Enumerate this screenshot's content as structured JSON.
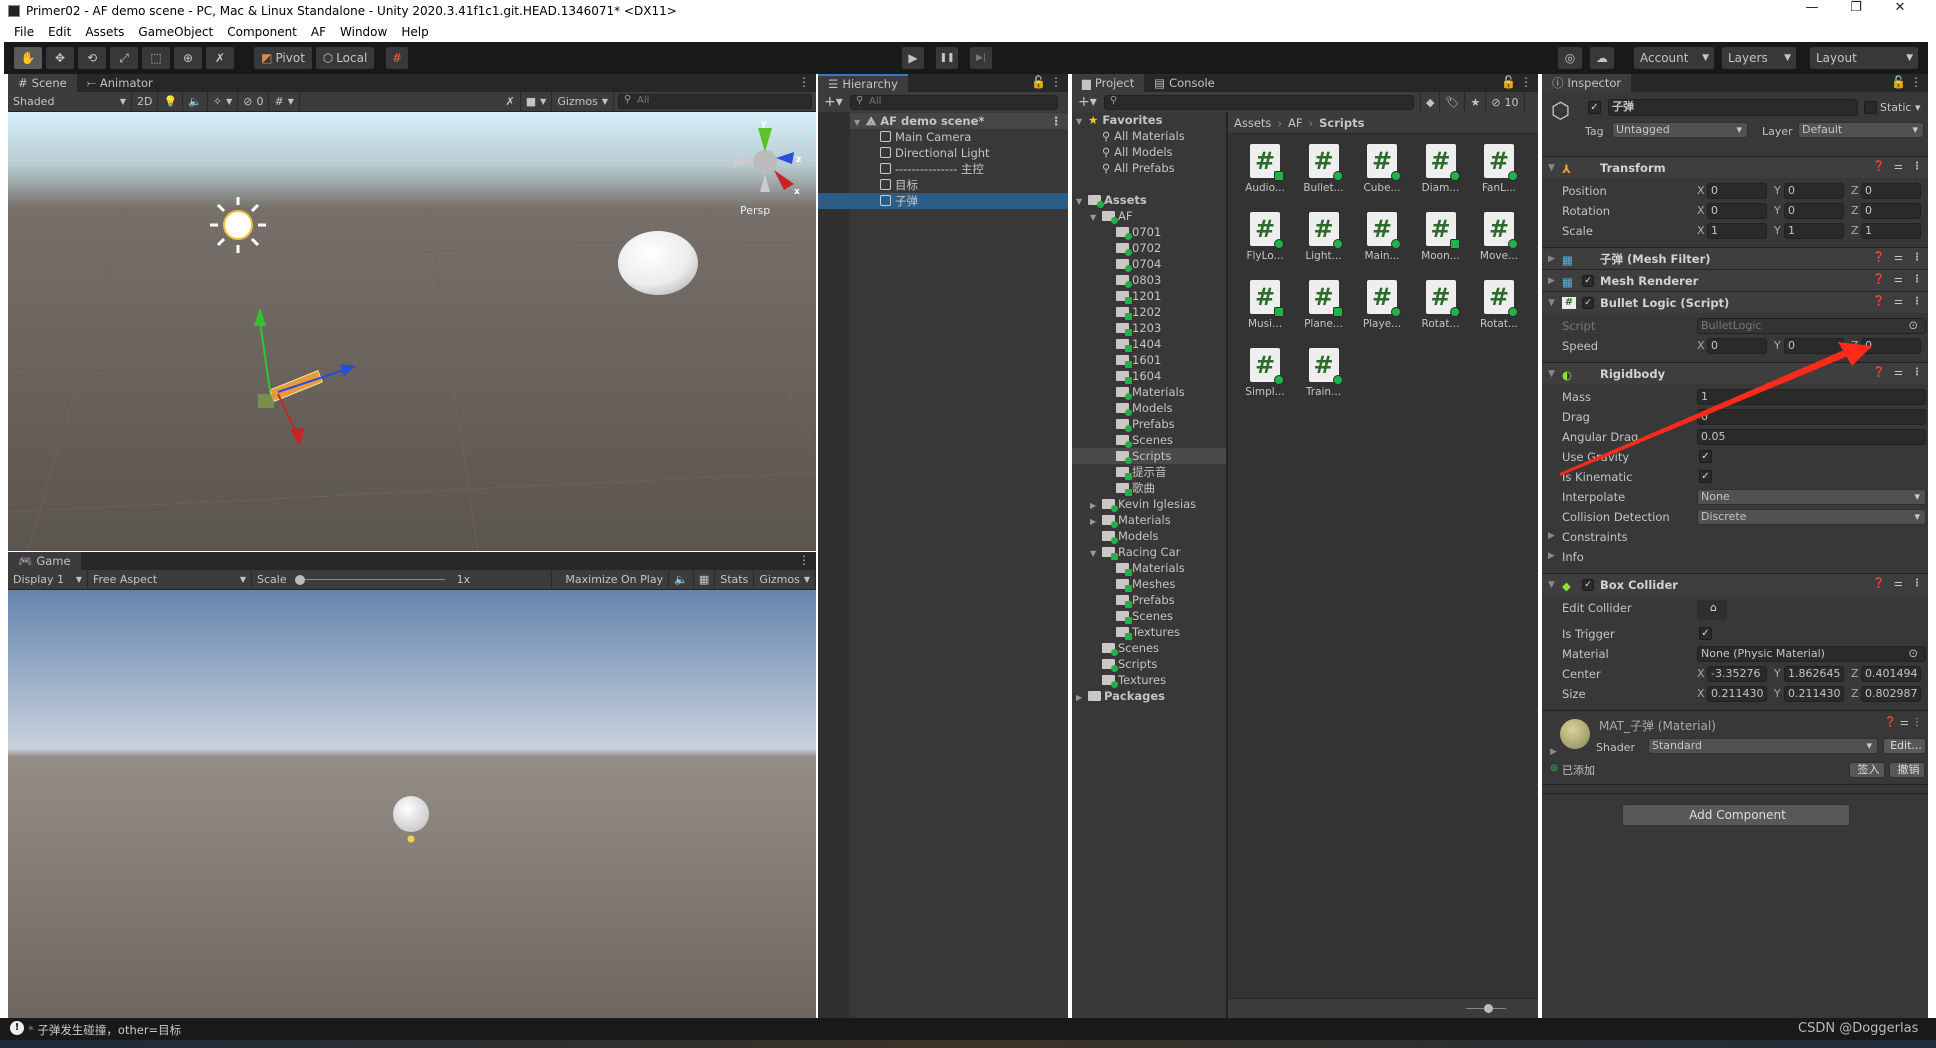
{
  "window": {
    "title": "Primer02 - AF demo scene - PC, Mac & Linux Standalone - Unity 2020.3.41f1c1.git.HEAD.1346071* <DX11>",
    "controls": [
      "—",
      "❐",
      "✕"
    ]
  },
  "menu": [
    "File",
    "Edit",
    "Assets",
    "GameObject",
    "Component",
    "AF",
    "Window",
    "Help"
  ],
  "toolbar": {
    "tools": [
      "hand-tool",
      "move-tool",
      "rotate-tool",
      "scale-tool",
      "rect-tool",
      "transform-tool",
      "custom-tool"
    ],
    "tool_glyphs": [
      "✋",
      "✥",
      "⟲",
      "⤢",
      "⬚",
      "⊕",
      "✗"
    ],
    "active_tool": "hand-tool",
    "pivot": "Pivot",
    "local": "Local",
    "play_glyphs": [
      "▶",
      "❚❚",
      "▶|"
    ],
    "account": "Account",
    "layers": "Layers",
    "layout": "Layout"
  },
  "scene": {
    "tabs": [
      "Scene",
      "Animator"
    ],
    "tab_glyphs": [
      "#",
      "⤚"
    ],
    "shading": "Shaded",
    "mode_2d": "2D",
    "hidden_count": "0",
    "gizmos": "Gizmos",
    "search_placeholder": "All",
    "projection": "Persp",
    "axis_labels": [
      "y",
      "z",
      "x"
    ]
  },
  "game": {
    "tab": "Game",
    "display": "Display 1",
    "aspect": "Free Aspect",
    "scale_label": "Scale",
    "scale_value": "1x",
    "maximize": "Maximize On Play",
    "stats": "Stats",
    "gizmos": "Gizmos"
  },
  "hierarchy": {
    "tab": "Hierarchy",
    "search_placeholder": "All",
    "scene_name": "AF demo scene*",
    "items": [
      {
        "label": "Main Camera",
        "selected": false
      },
      {
        "label": "Directional Light",
        "selected": false
      },
      {
        "label": "--------------- 主控",
        "selected": false
      },
      {
        "label": "目标",
        "selected": false
      },
      {
        "label": "子弹",
        "selected": true
      }
    ]
  },
  "project": {
    "tabs": [
      "Project",
      "Console"
    ],
    "hidden_count": "10",
    "breadcrumb": [
      "Assets",
      "AF",
      "Scripts"
    ],
    "tree": [
      {
        "label": "Favorites",
        "depth": 0,
        "arrow": "open",
        "icon": "star",
        "bold": true
      },
      {
        "label": "All Materials",
        "depth": 1,
        "arrow": "none",
        "icon": "search"
      },
      {
        "label": "All Models",
        "depth": 1,
        "arrow": "none",
        "icon": "search"
      },
      {
        "label": "All Prefabs",
        "depth": 1,
        "arrow": "none",
        "icon": "search"
      },
      {
        "label": "",
        "depth": 0,
        "arrow": "none",
        "icon": "none"
      },
      {
        "label": "Assets",
        "depth": 0,
        "arrow": "open",
        "icon": "folder",
        "vcs": "added",
        "bold": true
      },
      {
        "label": "AF",
        "depth": 1,
        "arrow": "open",
        "icon": "folder",
        "vcs": "added"
      },
      {
        "label": "0701",
        "depth": 2,
        "arrow": "none",
        "icon": "folder",
        "vcs": "added"
      },
      {
        "label": "0702",
        "depth": 2,
        "arrow": "none",
        "icon": "folder",
        "vcs": "added"
      },
      {
        "label": "0704",
        "depth": 2,
        "arrow": "none",
        "icon": "folder",
        "vcs": "added"
      },
      {
        "label": "0803",
        "depth": 2,
        "arrow": "none",
        "icon": "folder",
        "vcs": "added"
      },
      {
        "label": "1201",
        "depth": 2,
        "arrow": "none",
        "icon": "folder",
        "vcs": "modified"
      },
      {
        "label": "1202",
        "depth": 2,
        "arrow": "none",
        "icon": "folder",
        "vcs": "modified"
      },
      {
        "label": "1203",
        "depth": 2,
        "arrow": "none",
        "icon": "folder",
        "vcs": "modified"
      },
      {
        "label": "1404",
        "depth": 2,
        "arrow": "none",
        "icon": "folder",
        "vcs": "modified"
      },
      {
        "label": "1601",
        "depth": 2,
        "arrow": "none",
        "icon": "folder",
        "vcs": "modified"
      },
      {
        "label": "1604",
        "depth": 2,
        "arrow": "none",
        "icon": "folder",
        "vcs": "modified"
      },
      {
        "label": "Materials",
        "depth": 2,
        "arrow": "none",
        "icon": "folder",
        "vcs": "added"
      },
      {
        "label": "Models",
        "depth": 2,
        "arrow": "none",
        "icon": "folder",
        "vcs": "added"
      },
      {
        "label": "Prefabs",
        "depth": 2,
        "arrow": "none",
        "icon": "folder",
        "vcs": "added"
      },
      {
        "label": "Scenes",
        "depth": 2,
        "arrow": "none",
        "icon": "folder",
        "vcs": "added"
      },
      {
        "label": "Scripts",
        "depth": 2,
        "arrow": "none",
        "icon": "folder",
        "vcs": "added",
        "selected": true
      },
      {
        "label": "提示音",
        "depth": 2,
        "arrow": "none",
        "icon": "folder",
        "vcs": "modified"
      },
      {
        "label": "歌曲",
        "depth": 2,
        "arrow": "none",
        "icon": "folder",
        "vcs": "modified"
      },
      {
        "label": "Kevin Iglesias",
        "depth": 1,
        "arrow": "closed",
        "icon": "folder",
        "vcs": "added"
      },
      {
        "label": "Materials",
        "depth": 1,
        "arrow": "closed",
        "icon": "folder",
        "vcs": "added"
      },
      {
        "label": "Models",
        "depth": 1,
        "arrow": "none",
        "icon": "folder",
        "vcs": "added"
      },
      {
        "label": "Racing Car",
        "depth": 1,
        "arrow": "open",
        "icon": "folder",
        "vcs": "modified"
      },
      {
        "label": "Materials",
        "depth": 2,
        "arrow": "none",
        "icon": "folder",
        "vcs": "modified"
      },
      {
        "label": "Meshes",
        "depth": 2,
        "arrow": "none",
        "icon": "folder",
        "vcs": "modified"
      },
      {
        "label": "Prefabs",
        "depth": 2,
        "arrow": "none",
        "icon": "folder",
        "vcs": "modified"
      },
      {
        "label": "Scenes",
        "depth": 2,
        "arrow": "none",
        "icon": "folder",
        "vcs": "modified"
      },
      {
        "label": "Textures",
        "depth": 2,
        "arrow": "none",
        "icon": "folder",
        "vcs": "modified"
      },
      {
        "label": "Scenes",
        "depth": 1,
        "arrow": "none",
        "icon": "folder",
        "vcs": "added"
      },
      {
        "label": "Scripts",
        "depth": 1,
        "arrow": "none",
        "icon": "folder",
        "vcs": "added"
      },
      {
        "label": "Textures",
        "depth": 1,
        "arrow": "none",
        "icon": "folder",
        "vcs": "added"
      },
      {
        "label": "Packages",
        "depth": 0,
        "arrow": "closed",
        "icon": "folder-plain",
        "bold": true
      }
    ],
    "files": [
      {
        "label": "Audio...",
        "vcs": "modified"
      },
      {
        "label": "Bullet...",
        "vcs": "added"
      },
      {
        "label": "Cube...",
        "vcs": "added"
      },
      {
        "label": "Diam...",
        "vcs": "added"
      },
      {
        "label": "FanL...",
        "vcs": "added"
      },
      {
        "label": "FlyLo...",
        "vcs": "added"
      },
      {
        "label": "Light...",
        "vcs": "added"
      },
      {
        "label": "Main...",
        "vcs": "added"
      },
      {
        "label": "Moon...",
        "vcs": "modified"
      },
      {
        "label": "Move...",
        "vcs": "added"
      },
      {
        "label": "Musi...",
        "vcs": "modified"
      },
      {
        "label": "Plane...",
        "vcs": "modified"
      },
      {
        "label": "Playe...",
        "vcs": "added"
      },
      {
        "label": "Rotat...",
        "vcs": "added"
      },
      {
        "label": "Rotat...",
        "vcs": "added"
      },
      {
        "label": "Simpl...",
        "vcs": "added"
      },
      {
        "label": "Train...",
        "vcs": "added"
      }
    ]
  },
  "inspector": {
    "tab": "Inspector",
    "object": {
      "name": "子弹",
      "active": true,
      "static_label": "Static",
      "static": false,
      "tag_label": "Tag",
      "tag": "Untagged",
      "layer_label": "Layer",
      "layer": "Default"
    },
    "components": [
      {
        "title": "Transform",
        "icon": "transform",
        "expanded": true,
        "toggle": false,
        "rows": [
          {
            "label": "Position",
            "type": "vec3",
            "values": [
              "0",
              "0",
              "0"
            ]
          },
          {
            "label": "Rotation",
            "type": "vec3",
            "values": [
              "0",
              "0",
              "0"
            ]
          },
          {
            "label": "Scale",
            "type": "vec3",
            "values": [
              "1",
              "1",
              "1"
            ]
          }
        ]
      },
      {
        "title": "子弹 (Mesh Filter)",
        "icon": "mesh-filter",
        "expanded": false,
        "toggle": false,
        "rows": []
      },
      {
        "title": "Mesh Renderer",
        "icon": "mesh-renderer",
        "expanded": false,
        "toggle": true,
        "enabled": true,
        "rows": []
      },
      {
        "title": "Bullet Logic (Script)",
        "icon": "script",
        "expanded": true,
        "toggle": true,
        "enabled": true,
        "rows": [
          {
            "label": "Script",
            "type": "object",
            "value": "BulletLogic",
            "disabled": true
          },
          {
            "label": "Speed",
            "type": "vec3",
            "values": [
              "0",
              "0",
              "0"
            ]
          }
        ]
      },
      {
        "title": "Rigidbody",
        "icon": "rigidbody",
        "expanded": true,
        "toggle": false,
        "rows": [
          {
            "label": "Mass",
            "type": "text",
            "value": "1"
          },
          {
            "label": "Drag",
            "type": "text",
            "value": "0"
          },
          {
            "label": "Angular Drag",
            "type": "text",
            "value": "0.05"
          },
          {
            "label": "Use Gravity",
            "type": "check",
            "value": true
          },
          {
            "label": "Is Kinematic",
            "type": "check",
            "value": true
          },
          {
            "label": "Interpolate",
            "type": "dropdown",
            "value": "None"
          },
          {
            "label": "Collision Detection",
            "type": "dropdown",
            "value": "Discrete"
          },
          {
            "label": "Constraints",
            "type": "foldout"
          },
          {
            "label": "Info",
            "type": "foldout"
          }
        ]
      },
      {
        "title": "Box Collider",
        "icon": "box-collider",
        "expanded": true,
        "toggle": true,
        "enabled": true,
        "rows": [
          {
            "label": "Edit Collider",
            "type": "button"
          },
          {
            "label": "Is Trigger",
            "type": "check",
            "value": true
          },
          {
            "label": "Material",
            "type": "object",
            "value": "None (Physic Material)"
          },
          {
            "label": "Center",
            "type": "vec3",
            "values": [
              "-3.35276",
              "1.862645",
              "0.401494"
            ]
          },
          {
            "label": "Size",
            "type": "vec3",
            "values": [
              "0.211430",
              "0.211430",
              "0.802987"
            ]
          }
        ]
      }
    ],
    "material": {
      "name": "MAT_子弹 (Material)",
      "shader_label": "Shader",
      "shader": "Standard",
      "edit": "Edit...",
      "status": "已添加",
      "checkin": "签入",
      "revert": "撤销"
    },
    "add_component": "Add Component"
  },
  "status": {
    "message": "子弹发生碰撞，other=目标",
    "watermark": "CSDN @Doggerlas"
  },
  "colors": {
    "selection": "#2c5d87",
    "vcs_added": "#1fb34a",
    "annotation_arrow": "#ff2a1a",
    "panel": "#383838"
  }
}
